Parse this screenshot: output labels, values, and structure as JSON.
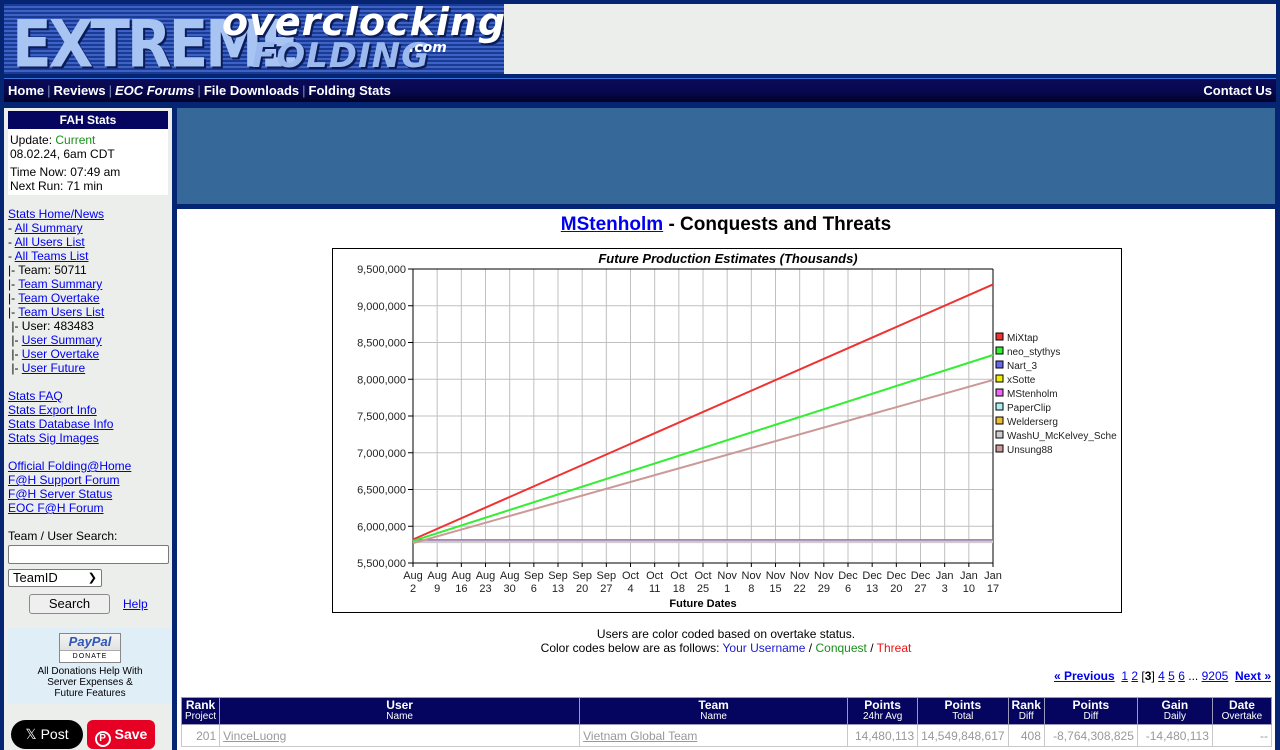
{
  "banner": {
    "logo_line1": "EXTREME",
    "logo_line2": "overclocking",
    "logo_line3": "FOLDING",
    "logo_com": ".com"
  },
  "nav": {
    "items": [
      {
        "label": "Home",
        "italic": false
      },
      {
        "label": "Reviews",
        "italic": false
      },
      {
        "label": "EOC Forums",
        "italic": true
      },
      {
        "label": "File Downloads",
        "italic": false
      },
      {
        "label": "Folding Stats",
        "italic": false
      }
    ],
    "separator": "|",
    "contact": "Contact Us"
  },
  "sidebar": {
    "fah_title": "FAH Stats",
    "update_label": "Update:",
    "update_status": "Current",
    "update_time": "08.02.24, 6am CDT",
    "time_now": "Time Now: 07:49 am",
    "next_run": "Next Run: 71 min",
    "links": [
      {
        "prefix": "",
        "label": "Stats Home/News",
        "link": true
      },
      {
        "prefix": "- ",
        "label": "All Summary",
        "link": true
      },
      {
        "prefix": "- ",
        "label": "All Users List",
        "link": true
      },
      {
        "prefix": "- ",
        "label": "All Teams List",
        "link": true
      },
      {
        "prefix": "|- ",
        "label": "Team: 50711",
        "link": false
      },
      {
        "prefix": "|- ",
        "label": "Team Summary",
        "link": true
      },
      {
        "prefix": "|- ",
        "label": "Team Overtake",
        "link": true
      },
      {
        "prefix": "|- ",
        "label": "Team Users List",
        "link": true
      },
      {
        "prefix": " |- ",
        "label": "User: 483483",
        "link": false
      },
      {
        "prefix": " |- ",
        "label": "User Summary",
        "link": true
      },
      {
        "prefix": " |- ",
        "label": "User Overtake",
        "link": true
      },
      {
        "prefix": " |- ",
        "label": "User Future",
        "link": true
      },
      {
        "blank": true
      },
      {
        "prefix": "",
        "label": "Stats FAQ",
        "link": true
      },
      {
        "prefix": "",
        "label": "Stats Export Info",
        "link": true
      },
      {
        "prefix": "",
        "label": "Stats Database Info",
        "link": true
      },
      {
        "prefix": "",
        "label": "Stats Sig Images",
        "link": true
      },
      {
        "blank": true
      },
      {
        "prefix": "",
        "label": "Official Folding@Home",
        "link": true
      },
      {
        "prefix": "",
        "label": "F@H Support Forum",
        "link": true
      },
      {
        "prefix": "",
        "label": "F@H Server Status",
        "link": true
      },
      {
        "prefix": "",
        "label": "EOC F@H Forum",
        "link": true
      }
    ],
    "search_label": "Team / User Search:",
    "search_value": "",
    "search_type": "TeamID",
    "search_button": "Search",
    "help_link": "Help",
    "paypal_logo": "PayPal",
    "paypal_donate": "DONATE",
    "donate_text_1": "All Donations Help With",
    "donate_text_2": "Server Expenses &",
    "donate_text_3": "Future Features",
    "x_post": "Post",
    "pin_save": "Save"
  },
  "main": {
    "title_user": "MStenholm",
    "title_rest": " - Conquests and Threats",
    "note_line1": "Users are color coded based on overtake status.",
    "note_line2_prefix": "Color codes below are as follows: ",
    "note_you": "Your Username",
    "note_sep": " / ",
    "note_conquest": "Conquest",
    "note_threat": "Threat",
    "pager": {
      "prev": "« Previous",
      "pages": [
        "1",
        "2",
        "3",
        "4",
        "5",
        "6"
      ],
      "current": "3",
      "ellipsis": "...",
      "last": "9205",
      "next": "Next »"
    },
    "table": {
      "headers": [
        {
          "top": "Rank",
          "sub": "Project"
        },
        {
          "top": "User",
          "sub": "Name"
        },
        {
          "top": "Team",
          "sub": "Name"
        },
        {
          "top": "Points",
          "sub": "24hr Avg"
        },
        {
          "top": "Points",
          "sub": "Total"
        },
        {
          "top": "Rank",
          "sub": "Diff"
        },
        {
          "top": "Points",
          "sub": "Diff"
        },
        {
          "top": "Gain",
          "sub": "Daily"
        },
        {
          "top": "Date",
          "sub": "Overtake"
        }
      ],
      "rows": [
        {
          "rank": "201",
          "user": "VinceLuong",
          "team": "Vietnam Global Team",
          "avg24": "14,480,113",
          "total": "14,549,848,617",
          "rank_diff": "408",
          "points_diff": "-8,764,308,825",
          "gain_daily": "-14,480,113",
          "date_overtake": "--"
        }
      ]
    }
  },
  "chart_data": {
    "type": "line",
    "title": "Future Production Estimates (Thousands)",
    "xlabel": "Future Dates",
    "ylabel": "",
    "x": [
      "Aug 2",
      "Aug 9",
      "Aug 16",
      "Aug 23",
      "Aug 30",
      "Sep 6",
      "Sep 13",
      "Sep 20",
      "Sep 27",
      "Oct 4",
      "Oct 11",
      "Oct 18",
      "Oct 25",
      "Nov 1",
      "Nov 8",
      "Nov 15",
      "Nov 22",
      "Nov 29",
      "Dec 6",
      "Dec 13",
      "Dec 20",
      "Dec 27",
      "Jan 3",
      "Jan 10",
      "Jan 17"
    ],
    "ylim": [
      5500000,
      9500000
    ],
    "yticks": [
      5500000,
      6000000,
      6500000,
      7000000,
      7500000,
      8000000,
      8500000,
      9000000,
      9500000
    ],
    "ytick_labels": [
      "5,500,000",
      "6,000,000",
      "6,500,000",
      "7,000,000",
      "7,500,000",
      "8,000,000",
      "8,500,000",
      "9,000,000",
      "9,500,000"
    ],
    "grid": true,
    "legend_position": "right",
    "series": [
      {
        "name": "MiXtap",
        "color": "#ee3333",
        "start": 5820000,
        "end": 9290000
      },
      {
        "name": "neo_stythys",
        "color": "#33ee33",
        "start": 5800000,
        "end": 8330000
      },
      {
        "name": "Nart_3",
        "color": "#6666ee",
        "start": 5810000,
        "end": 5810000
      },
      {
        "name": "xSotte",
        "color": "#eeee00",
        "start": 5795000,
        "end": 5795000
      },
      {
        "name": "MStenholm",
        "color": "#ee66ee",
        "start": 5790000,
        "end": 5790000
      },
      {
        "name": "PaperClip",
        "color": "#aaeeee",
        "start": 5788000,
        "end": 5788000
      },
      {
        "name": "Welderserg",
        "color": "#eebb33",
        "start": 5786000,
        "end": 5786000
      },
      {
        "name": "WashU_McKelvey_Sche",
        "color": "#cccccc",
        "start": 5784000,
        "end": 5784000
      },
      {
        "name": "Unsung88",
        "color": "#cc9999",
        "start": 5770000,
        "end": 7990000
      }
    ]
  }
}
